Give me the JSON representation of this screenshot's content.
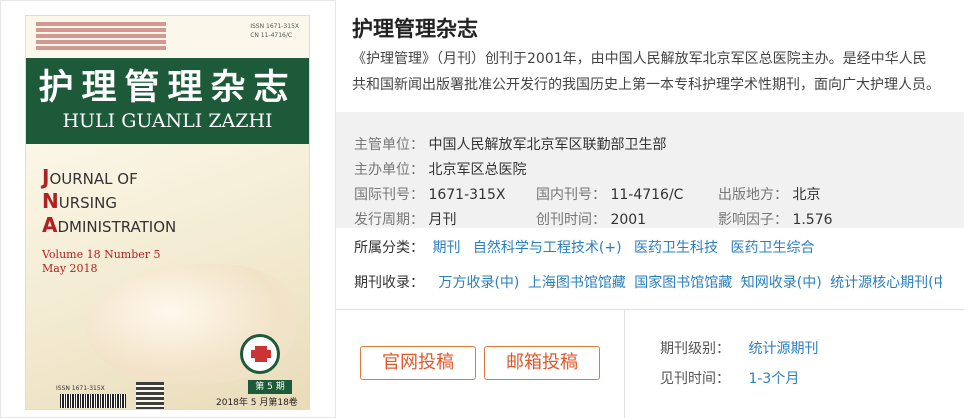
{
  "journal": {
    "title": "护理管理杂志",
    "description_line1": "《护理管理》（月刊）创刊于2001年，由中国人民解放军北京军区总医院主办。是经中华人民",
    "description_line2": "共和国新闻出版署批准公开发行的我国历史上第一本专科护理学术性期刊，面向广大护理人员。"
  },
  "cover": {
    "title_cn": "护理管理杂志",
    "title_pinyin": "HULI GUANLI ZAZHI",
    "journal_en_line1": "OURNAL OF",
    "journal_en_line2": "URSING",
    "journal_en_line3": "DMINISTRATION",
    "journal_en_initial1": "J",
    "journal_en_initial2": "N",
    "journal_en_initial3": "A",
    "volume": "Volume 18  Number 5",
    "date": "May  2018",
    "issn_top": "ISSN 1671-315X",
    "cn_top": "CN 11-4716/C",
    "issue_label": "第 5 期",
    "issue_date": "2018年 5 月第18卷",
    "barcode_label": "ISSN 1671-315X"
  },
  "info": {
    "supervisor_label": "主管单位：",
    "supervisor_value": "中国人民解放军北京军区联勤部卫生部",
    "sponsor_label": "主办单位：",
    "sponsor_value": "北京军区总医院",
    "issn_label": "国际刊号：",
    "issn_value": "1671-315X",
    "cn_label": "国内刊号：",
    "cn_value": "11-4716/C",
    "place_label": "出版地方：",
    "place_value": "北京",
    "cycle_label": "发行周期：",
    "cycle_value": "月刊",
    "founded_label": "创刊时间：",
    "founded_value": "2001",
    "impact_label": "影响因子：",
    "impact_value": "1.576"
  },
  "categories": {
    "label": "所属分类：",
    "items": [
      "期刊",
      "自然科学与工程技术(+)",
      "医药卫生科技",
      "医药卫生综合"
    ]
  },
  "inclusion": {
    "label": "期刊收录：",
    "items": [
      "万方收录(中)",
      "上海图书馆馆藏",
      "国家图书馆馆藏",
      "知网收录(中)",
      "统计源核心期刊(中国"
    ]
  },
  "actions": {
    "official_submit": "官网投稿",
    "email_submit": "邮箱投稿"
  },
  "meta": {
    "level_label": "期刊级别：",
    "level_value": "统计源期刊",
    "time_label": "见刊时间：",
    "time_value": "1-3个月"
  },
  "colors": {
    "accent_orange": "#e0582a",
    "link_blue": "#2a7fbf",
    "cover_green": "#1d5a3a"
  }
}
